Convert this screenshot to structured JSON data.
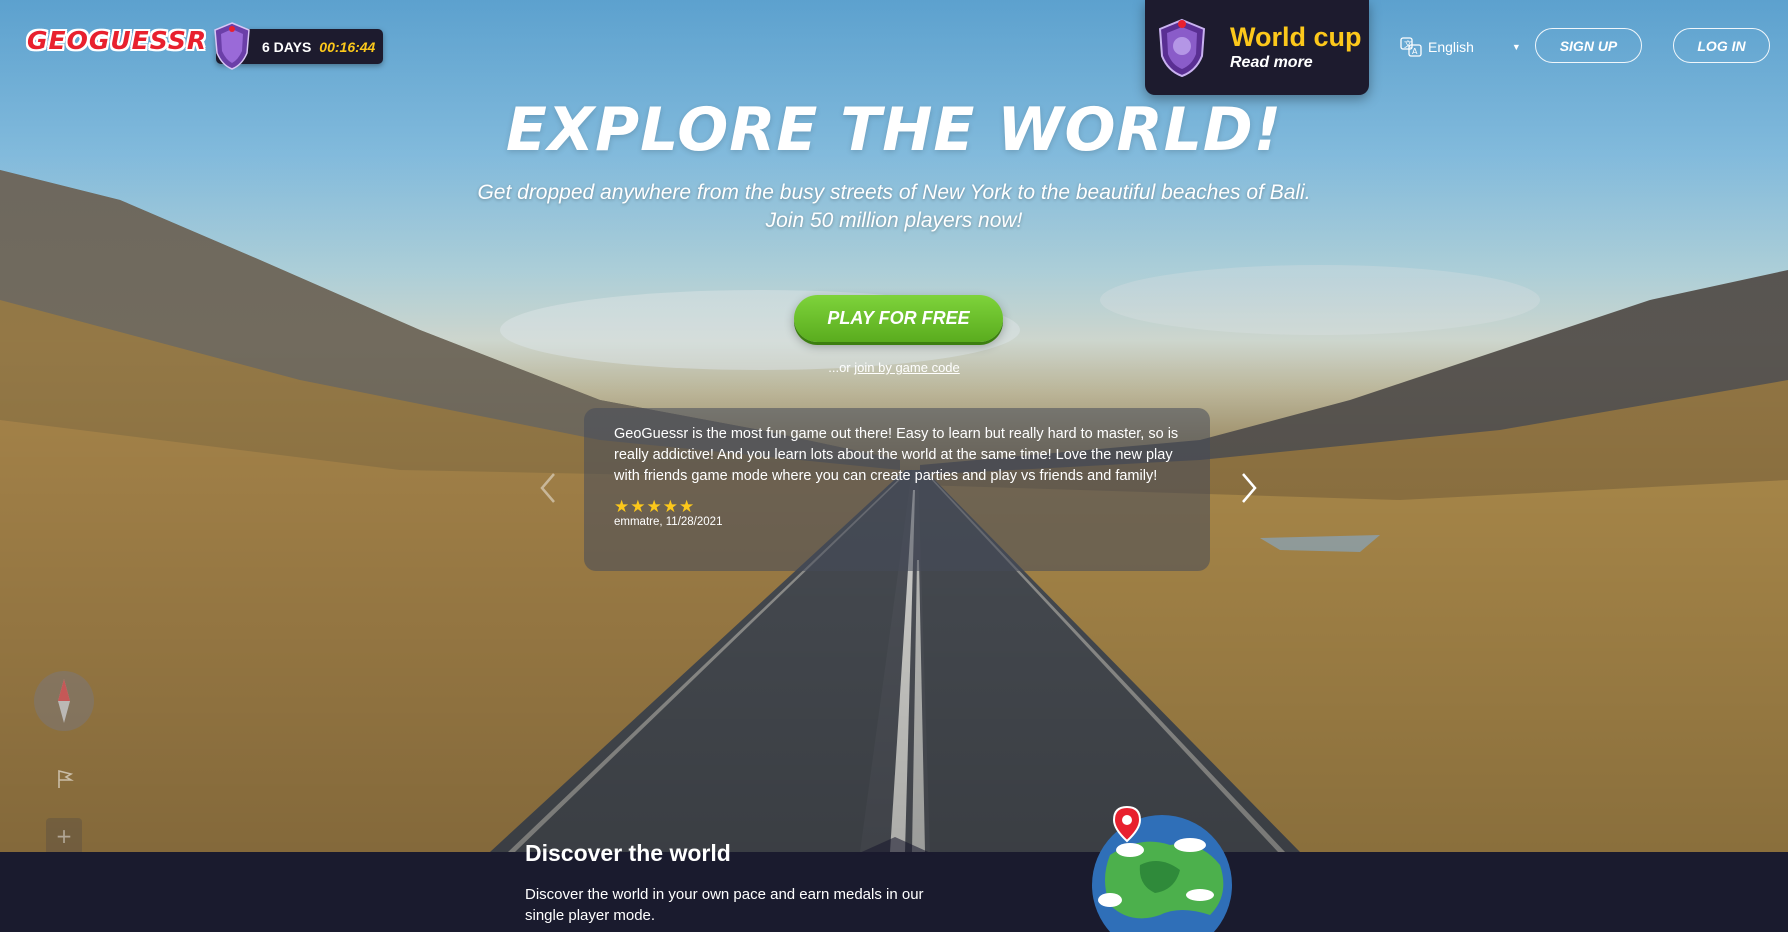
{
  "header": {
    "logo_text": "GEOGUESSR",
    "countdown": {
      "days_label": "6 DAYS",
      "timer": "00:16:44"
    },
    "world_cup": {
      "title": "World cup",
      "read_more": "Read more"
    },
    "language": "English",
    "signup_label": "SIGN UP",
    "login_label": "LOG IN"
  },
  "hero": {
    "title": "EXPLORE THE WORLD!",
    "subtitle_line1": "Get dropped anywhere from the busy streets of New York to the beautiful beaches of Bali.",
    "subtitle_line2": "Join 50 million players now!",
    "play_label": "PLAY FOR FREE",
    "join_prefix": "...or ",
    "join_link": "join by game code"
  },
  "review": {
    "text": "GeoGuessr is the most fun game out there! Easy to learn but really hard to master, so is really addictive! And you learn lots about the world at the same time! Love the new play with friends game mode where you can create parties and play vs friends and family!",
    "stars": "★★★★★",
    "rating": 5,
    "author": "emmatre, 11/28/2021"
  },
  "controls": {
    "zoom_in": "+",
    "zoom_out": "−"
  },
  "discover": {
    "title": "Discover the world",
    "text": "Discover the world in your own pace and earn medals in our single player mode."
  },
  "colors": {
    "brand_red": "#e8202e",
    "gold": "#fcc81b",
    "play_green": "#6ac12b",
    "dark_panel": "#1d1b2e"
  }
}
